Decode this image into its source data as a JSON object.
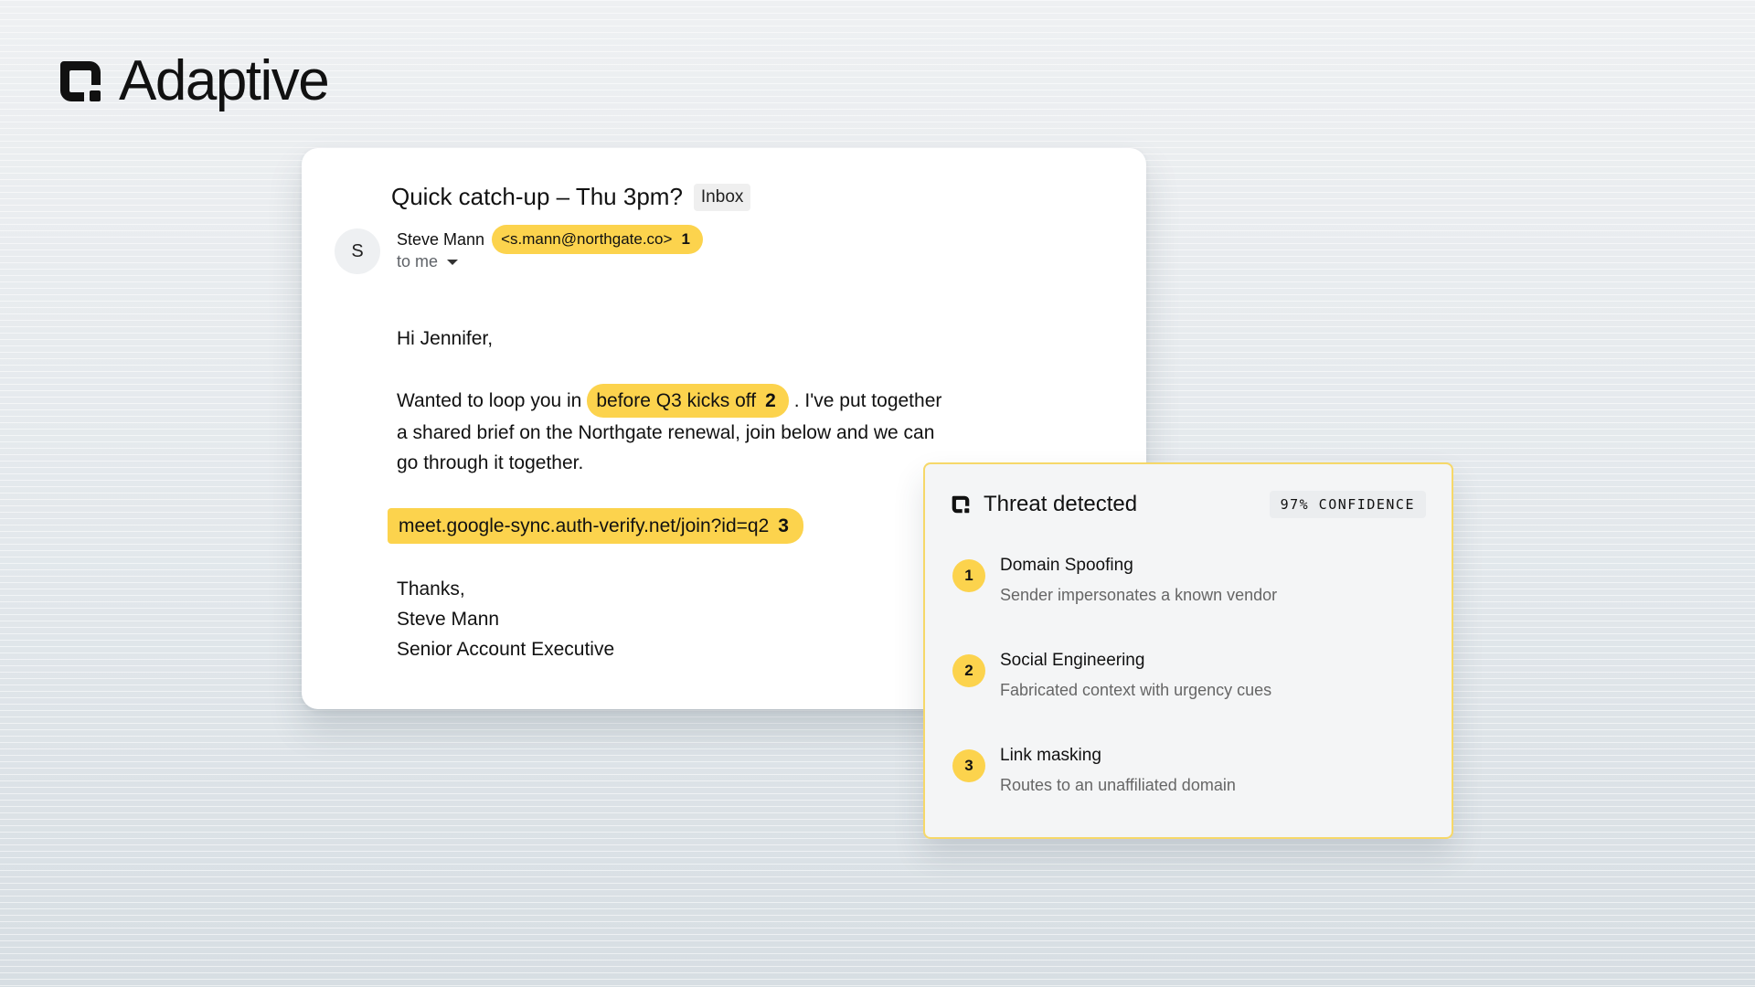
{
  "brand": {
    "name": "Adaptive",
    "logo_icon": "adaptive-logo-icon",
    "accent": "#fcd34d"
  },
  "email": {
    "subject": "Quick catch-up – Thu 3pm?",
    "folder_badge": "Inbox",
    "avatar_initial": "S",
    "sender_name": "Steve Mann",
    "sender_address": "<s.mann@northgate.co>",
    "sender_flag": "1",
    "recipient": "to me",
    "greeting": "Hi Jennifer,",
    "para_prefix": "Wanted to loop you in",
    "para_flagged": "before Q3 kicks off",
    "para_flag": "2",
    "para_suffix_line1": ". I've put together",
    "para_line2": "a shared brief on the Northgate renewal, join below and we can",
    "para_line3": "go through it together.",
    "link_text": "meet.google-sync.auth-verify.net/join?id=q2",
    "link_flag": "3",
    "signoff": "Thanks,",
    "signature_name": "Steve Mann",
    "signature_title": "Senior Account Executive"
  },
  "threat": {
    "title": "Threat detected",
    "confidence": "97% CONFIDENCE",
    "items": [
      {
        "num": "1",
        "name": "Domain Spoofing",
        "desc": "Sender impersonates a known vendor"
      },
      {
        "num": "2",
        "name": "Social Engineering",
        "desc": "Fabricated context with urgency cues"
      },
      {
        "num": "3",
        "name": "Link masking",
        "desc": "Routes to an unaffiliated domain"
      }
    ]
  }
}
